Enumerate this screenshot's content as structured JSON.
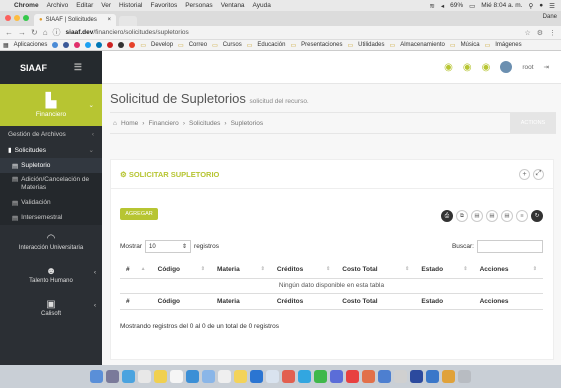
{
  "macmenu": {
    "app": "Chrome",
    "items": [
      "Archivo",
      "Editar",
      "Ver",
      "Historial",
      "Favoritos",
      "Personas",
      "Ventana",
      "Ayuda"
    ],
    "battery": "69%",
    "clock": "Mié 8:04 a. m."
  },
  "browser": {
    "tab_title": "SIAAF | Solicitudes",
    "profile": "Dane",
    "url_host": "siaaf.dev",
    "url_path": "/financiero/solicitudes/supletorios",
    "bookmarks": [
      "Aplicaciones",
      "Develop",
      "Correo",
      "Cursos",
      "Educación",
      "Presentaciones",
      "Utilidades",
      "Almacenamiento",
      "Música",
      "Imágenes"
    ]
  },
  "sidebar": {
    "brand": "SIAAF",
    "module": "Financiero",
    "items": [
      {
        "label": "Gestión de Archivos"
      },
      {
        "label": "Solicitudes"
      }
    ],
    "subitems": [
      {
        "label": "Supletorio"
      },
      {
        "label": "Adición/Cancelación de Materias"
      },
      {
        "label": "Validación"
      },
      {
        "label": "Intersemestral"
      }
    ],
    "modules": [
      {
        "label": "Interacción Universitaria"
      },
      {
        "label": "Talento Humano"
      },
      {
        "label": "Calisoft"
      }
    ]
  },
  "topbar": {
    "user": "root"
  },
  "page": {
    "title": "Solicitud de Supletorios",
    "subtitle": "solicitud del recurso.",
    "breadcrumb": [
      "Home",
      "Financiero",
      "Solicitudes",
      "Supletorios"
    ],
    "actions": "ACTIONS"
  },
  "panel": {
    "title": "SOLICITAR SUPLETORIO",
    "add_label": "AGREGAR",
    "show_label": "Mostrar",
    "page_size": "10",
    "records_label": "registros",
    "search_label": "Buscar:",
    "columns": [
      "#",
      "Código",
      "Materia",
      "Créditos",
      "Costo Total",
      "Estado",
      "Acciones"
    ],
    "empty_message": "Ningún dato disponible en esta tabla",
    "info": "Mostrando registros del 0 al 0 de un total de 0 registros"
  },
  "colors": {
    "accent": "#b7c532",
    "sidebar": "#2b2f34"
  }
}
